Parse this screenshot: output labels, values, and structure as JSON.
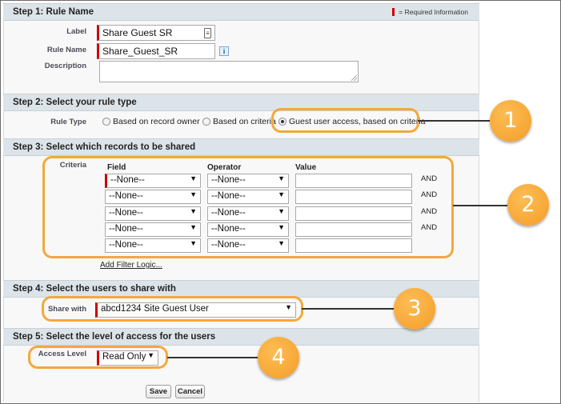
{
  "legend": {
    "required_info": "= Required Information"
  },
  "step1": {
    "title": "Step 1: Rule Name",
    "label_label": "Label",
    "label_value": "Share Guest SR",
    "rule_name_label": "Rule Name",
    "rule_name_value": "Share_Guest_SR",
    "description_label": "Description",
    "description_value": ""
  },
  "step2": {
    "title": "Step 2: Select your rule type",
    "rule_type_label": "Rule Type",
    "options": [
      {
        "label": "Based on record owner",
        "checked": false
      },
      {
        "label": "Based on criteria",
        "checked": false
      },
      {
        "label": "Guest user access, based on criteria",
        "checked": true
      }
    ]
  },
  "step3": {
    "title": "Step 3: Select which records to be shared",
    "criteria_label": "Criteria",
    "columns": {
      "field": "Field",
      "operator": "Operator",
      "value": "Value"
    },
    "rows": [
      {
        "field": "--None--",
        "operator": "--None--",
        "value": "",
        "conjunction": "AND"
      },
      {
        "field": "--None--",
        "operator": "--None--",
        "value": "",
        "conjunction": "AND"
      },
      {
        "field": "--None--",
        "operator": "--None--",
        "value": "",
        "conjunction": "AND"
      },
      {
        "field": "--None--",
        "operator": "--None--",
        "value": "",
        "conjunction": "AND"
      },
      {
        "field": "--None--",
        "operator": "--None--",
        "value": "",
        "conjunction": ""
      }
    ],
    "add_filter_logic": "Add Filter Logic..."
  },
  "step4": {
    "title": "Step 4: Select the users to share with",
    "share_with_label": "Share with",
    "share_with_value": "abcd1234 Site Guest User"
  },
  "step5": {
    "title": "Step 5: Select the level of access for the users",
    "access_level_label": "Access Level",
    "access_level_value": "Read Only"
  },
  "buttons": {
    "save": "Save",
    "cancel": "Cancel"
  },
  "callouts": {
    "one": "1",
    "two": "2",
    "three": "3",
    "four": "4"
  },
  "colors": {
    "callout": "#f4a83a",
    "required": "#cc0000",
    "section_header": "#dde4e9"
  }
}
